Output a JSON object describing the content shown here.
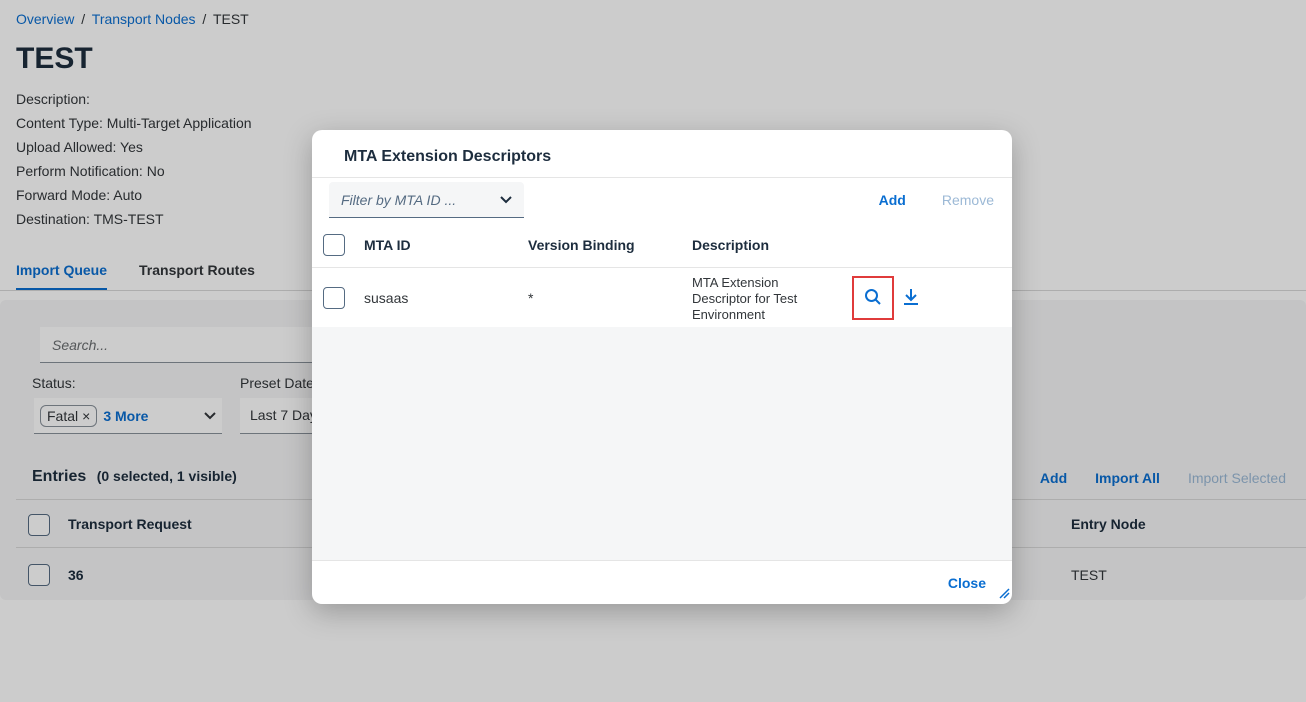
{
  "breadcrumb": {
    "overview": "Overview",
    "sep": "/",
    "transport_nodes": "Transport Nodes",
    "current": "TEST"
  },
  "page": {
    "title": "TEST",
    "props": [
      "Description:",
      "Content Type: Multi-Target Application",
      "Upload Allowed: Yes",
      "Perform Notification: No",
      "Forward Mode: Auto",
      "Destination: TMS-TEST"
    ],
    "tabs": [
      {
        "label": "Import Queue",
        "active": true
      },
      {
        "label": "Transport Routes",
        "active": false
      }
    ]
  },
  "queue": {
    "search_placeholder": "Search...",
    "status_label": "Status:",
    "status_token": "Fatal",
    "status_more": "3 More",
    "preset_label": "Preset Date",
    "preset_value": "Last 7 Day",
    "entries_title": "Entries",
    "entries_sub": "(0 selected, 1 visible)",
    "actions": {
      "add": "Add",
      "import_all": "Import All",
      "import_selected": "Import Selected"
    },
    "columns": {
      "transport_request": "Transport Request",
      "entry_node": "Entry Node"
    },
    "rows": [
      {
        "transport_request": "36",
        "entry_node": "TEST"
      }
    ]
  },
  "dialog": {
    "title": "MTA Extension Descriptors",
    "filter_placeholder": "Filter by MTA ID ...",
    "add": "Add",
    "remove": "Remove",
    "columns": {
      "mta_id": "MTA ID",
      "version_binding": "Version Binding",
      "description": "Description"
    },
    "rows": [
      {
        "mta_id": "susaas",
        "version_binding": "*",
        "description": "MTA Extension Descriptor for Test Environment"
      }
    ],
    "close": "Close"
  },
  "colors": {
    "accent": "#0a6ed1",
    "highlight": "#e03b3b"
  },
  "icons": {
    "search": "search-icon",
    "download": "download-icon",
    "chevron": "chevron-down-icon",
    "remove_token": "close-icon",
    "resize": "resize-handle-icon"
  }
}
